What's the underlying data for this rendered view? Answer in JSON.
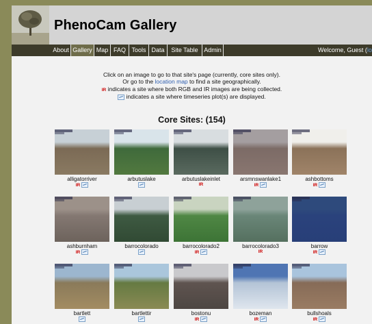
{
  "header": {
    "title": "PhenoCam Gallery"
  },
  "nav": {
    "items": [
      {
        "label": "About",
        "active": false
      },
      {
        "label": "Gallery",
        "active": true
      },
      {
        "label": "Map",
        "active": false
      },
      {
        "label": "FAQ",
        "active": false
      },
      {
        "label": "Tools",
        "active": false
      },
      {
        "label": "Data",
        "active": false
      },
      {
        "label": "Site Table",
        "active": false
      },
      {
        "label": "Admin",
        "active": false
      }
    ],
    "welcome_prefix": "Welcome, Guest (",
    "welcome_link": "log"
  },
  "intro": {
    "line1": "Click on an image to go to that site's page (currently, core sites only).",
    "line2_pre": "Or go to the ",
    "line2_link": "location map",
    "line2_post": " to find a site geographically.",
    "ir_tag": "IR",
    "line3": " indicates a site where both RGB and IR images are being collected.",
    "line4": " indicates a site where timeseries plot(s) are displayed."
  },
  "section": {
    "title": "Core Sites: (154)"
  },
  "sites": [
    {
      "name": "alligatorriver",
      "ir": true,
      "ts": true,
      "sky": "#c7d0d6",
      "land": "#7b6a55",
      "ground": "#8a7a62"
    },
    {
      "name": "arbutuslake",
      "ir": false,
      "ts": true,
      "sky": "#d9e4ea",
      "land": "#3f6a3b",
      "ground": "#52793f"
    },
    {
      "name": "arbutuslakeinlet",
      "ir": true,
      "ts": false,
      "sky": "#d8dde0",
      "land": "#3e4f46",
      "ground": "#5a6a5f"
    },
    {
      "name": "arsmnswanlake1",
      "ir": true,
      "ts": true,
      "sky": "#a49ea0",
      "land": "#7c6b66",
      "ground": "#897670"
    },
    {
      "name": "ashbottoms",
      "ir": true,
      "ts": true,
      "sky": "#f0efeb",
      "land": "#8b7259",
      "ground": "#a08469"
    },
    {
      "name": "ashburnham",
      "ir": true,
      "ts": true,
      "sky": "#9c9189",
      "land": "#847872",
      "ground": "#6d635c"
    },
    {
      "name": "barrocolorado",
      "ir": false,
      "ts": true,
      "sky": "#c8cfd3",
      "land": "#3e5a42",
      "ground": "#314a34"
    },
    {
      "name": "barrocolorado2",
      "ir": true,
      "ts": true,
      "sky": "#c9d4c0",
      "land": "#4f8744",
      "ground": "#3d7436"
    },
    {
      "name": "barrocolorado3",
      "ir": true,
      "ts": false,
      "sky": "#8ea29a",
      "land": "#6a8678",
      "ground": "#55705f"
    },
    {
      "name": "barrow",
      "ir": true,
      "ts": true,
      "sky": "#2e4a7c",
      "land": "#2a427c",
      "ground": "#283f78"
    },
    {
      "name": "bartlett",
      "ir": false,
      "ts": true,
      "sky": "#9cb6cf",
      "land": "#8a7a5a",
      "ground": "#a38c62"
    },
    {
      "name": "bartlettir",
      "ir": false,
      "ts": true,
      "sky": "#aac6dc",
      "land": "#657a42",
      "ground": "#8a8a54"
    },
    {
      "name": "bostonu",
      "ir": true,
      "ts": true,
      "sky": "#c9c9cc",
      "land": "#5f5450",
      "ground": "#4d4642"
    },
    {
      "name": "bozeman",
      "ir": true,
      "ts": true,
      "sky": "#4f75b3",
      "land": "#b3c3d6",
      "ground": "#dfe6ee"
    },
    {
      "name": "bullshoals",
      "ir": true,
      "ts": true,
      "sky": "#a9c4dd",
      "land": "#866b57",
      "ground": "#9a7c63"
    }
  ]
}
